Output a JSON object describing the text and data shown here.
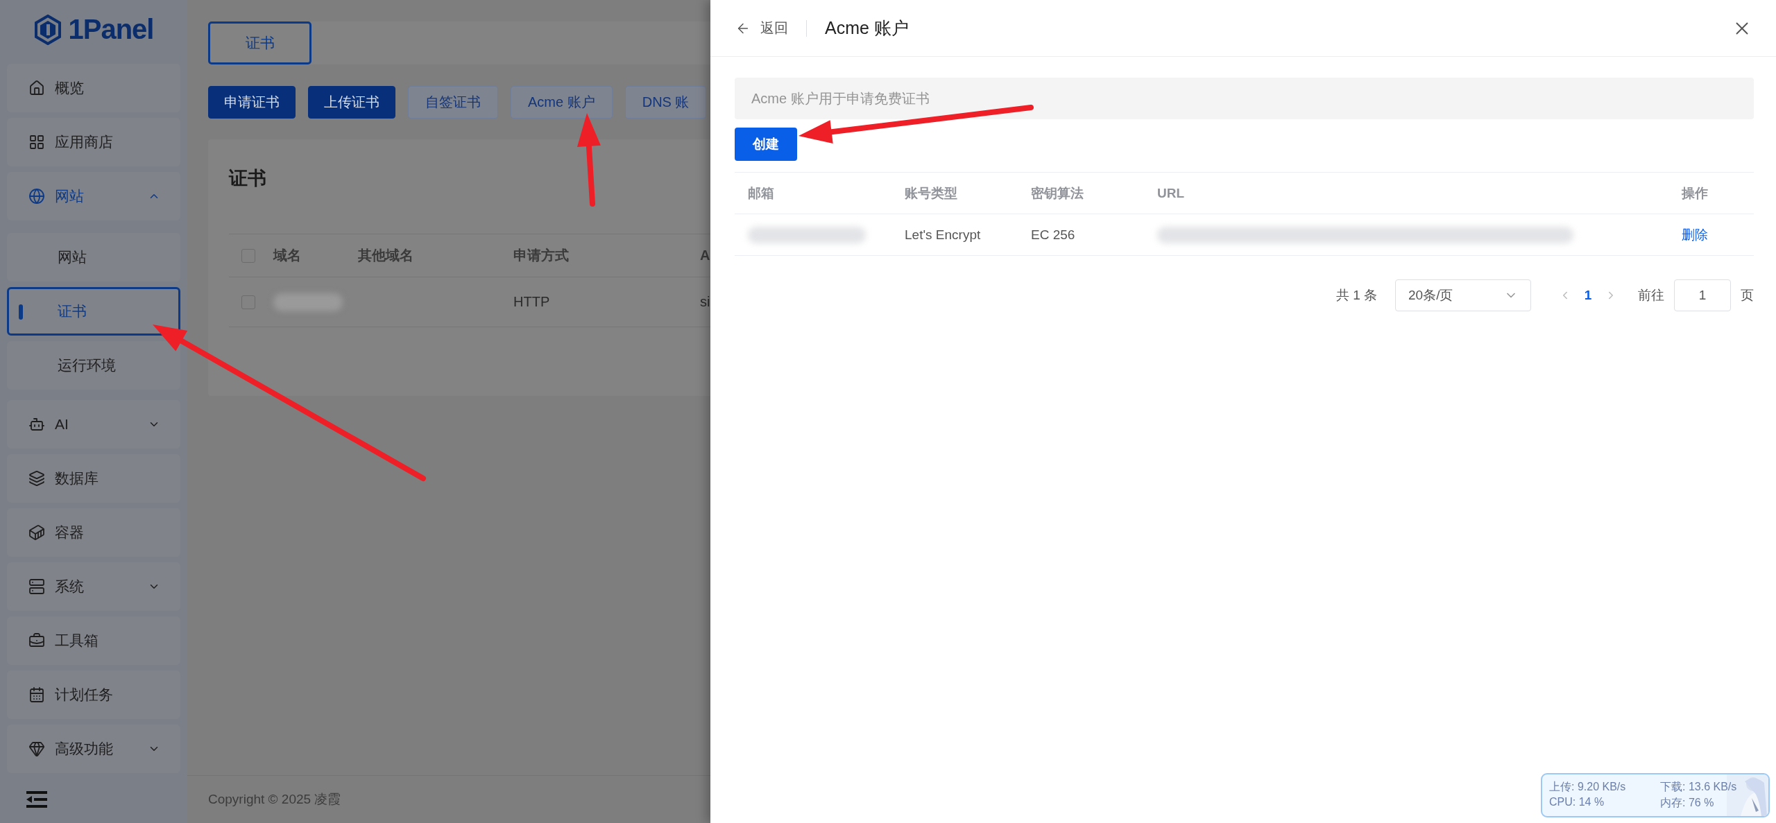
{
  "sidebar": {
    "logo": "1Panel",
    "items": [
      {
        "label": "概览"
      },
      {
        "label": "应用商店"
      },
      {
        "label": "网站",
        "expanded": true,
        "children": [
          {
            "label": "网站",
            "selected": false
          },
          {
            "label": "证书",
            "selected": true
          },
          {
            "label": "运行环境",
            "selected": false
          }
        ]
      },
      {
        "label": "AI",
        "expanded": false
      },
      {
        "label": "数据库"
      },
      {
        "label": "容器"
      },
      {
        "label": "系统",
        "expanded": false
      },
      {
        "label": "工具箱"
      },
      {
        "label": "计划任务"
      },
      {
        "label": "高级功能",
        "expanded": false
      }
    ]
  },
  "main": {
    "tabs": [
      {
        "label": "证书",
        "selected": true
      }
    ],
    "actions": [
      {
        "label": "申请证书",
        "kind": "primary"
      },
      {
        "label": "上传证书",
        "kind": "primary"
      },
      {
        "label": "自签证书",
        "kind": "plain"
      },
      {
        "label": "Acme 账户",
        "kind": "plain"
      },
      {
        "label": "DNS 账",
        "kind": "plain"
      }
    ],
    "card": {
      "title": "证书",
      "columns": [
        "域名",
        "其他域名",
        "申请方式",
        "A"
      ],
      "header_checked": false,
      "rows": [
        {
          "checked": false,
          "cells": [
            {
              "kind": "redacted"
            },
            {
              "kind": "text",
              "text": ""
            },
            {
              "kind": "text",
              "text": "HTTP"
            },
            {
              "kind": "text",
              "text": "si"
            }
          ]
        }
      ]
    },
    "footer": "Copyright © 2025 凌霞"
  },
  "drawer": {
    "back": "返回",
    "title": "Acme 账户",
    "alert": "Acme 账户用于申请免费证书",
    "create": "创建",
    "columns": [
      "邮箱",
      "账号类型",
      "密钥算法",
      "URL",
      "操作"
    ],
    "rows": [
      {
        "cells": [
          {
            "kind": "redacted"
          },
          {
            "kind": "text",
            "text": "Let's Encrypt"
          },
          {
            "kind": "text",
            "text": "EC 256"
          },
          {
            "kind": "redacted"
          },
          {
            "kind": "link",
            "text": "删除"
          }
        ]
      }
    ],
    "pagination": {
      "total": "共 1 条",
      "page_size": "20条/页",
      "pages": [
        {
          "label": "1",
          "selected": true
        }
      ],
      "goto": "前往",
      "goto_value": "1",
      "suffix": "页"
    }
  },
  "monitor": {
    "upload": "上传: 9.20 KB/s",
    "download": "下载: 13.6 KB/s",
    "cpu": "CPU: 14 %",
    "memory": "内存: 76 %"
  }
}
